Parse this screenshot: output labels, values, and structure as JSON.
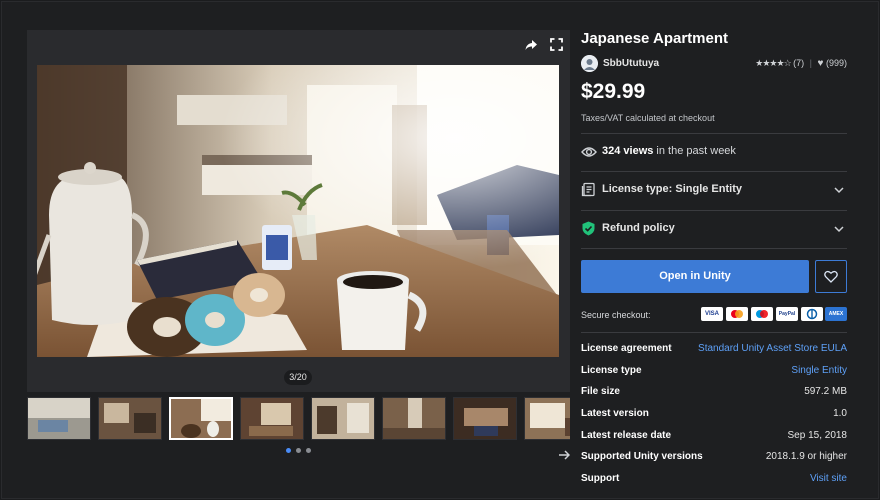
{
  "gallery": {
    "counter": "3/20",
    "thumbnail_count": 8,
    "active_thumbnail": 3,
    "dot_count": 3,
    "active_dot": 1
  },
  "product": {
    "title": "Japanese Apartment",
    "publisher": "SbbUtutuya",
    "rating_stars": "★★★★☆",
    "rating_count": "(7)",
    "favorites": "(999)",
    "price": "$29.99",
    "vat_note": "Taxes/VAT calculated at checkout"
  },
  "views": {
    "count": "324 views",
    "suffix": " in the past week"
  },
  "accordions": [
    {
      "label": "License type: Single Entity",
      "icon": "license-icon"
    },
    {
      "label": "Refund policy",
      "icon": "shield-check-icon"
    }
  ],
  "actions": {
    "open_label": "Open in Unity",
    "favorite_icon": "heart-icon"
  },
  "checkout": {
    "label": "Secure checkout:",
    "cards": [
      "VISA",
      "MC",
      "MAE",
      "PayPal",
      "DC",
      "AMEX"
    ]
  },
  "specs": [
    {
      "key": "License agreement",
      "value": "Standard Unity Asset Store EULA",
      "link": true
    },
    {
      "key": "License type",
      "value": "Single Entity",
      "link": true
    },
    {
      "key": "File size",
      "value": "597.2 MB",
      "link": false
    },
    {
      "key": "Latest version",
      "value": "1.0",
      "link": false
    },
    {
      "key": "Latest release date",
      "value": "Sep 15, 2018",
      "link": false
    },
    {
      "key": "Supported Unity versions",
      "value": "2018.1.9 or higher",
      "link": false
    },
    {
      "key": "Support",
      "value": "Visit site",
      "link": true
    }
  ],
  "colors": {
    "accent": "#3d7bd6",
    "link": "#5ea0f7",
    "background": "#1e1f21",
    "shield": "#21c27a"
  }
}
